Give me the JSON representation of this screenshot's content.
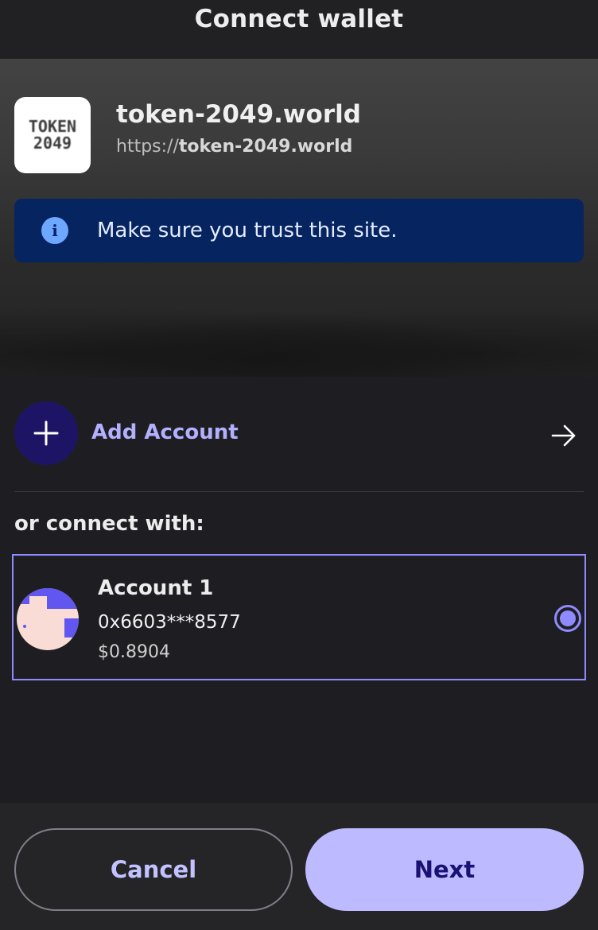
{
  "header": {
    "title": "Connect wallet"
  },
  "site": {
    "logo_line1": "TOKEN",
    "logo_line2": "2049",
    "name": "token-2049.world",
    "url_prefix": "https://",
    "url_host": "token-2049.world",
    "trust_message": "Make sure you trust this site."
  },
  "add_account": {
    "label": "Add Account",
    "icon": "plus-icon",
    "arrow_icon": "arrow-right-icon"
  },
  "connect_with_label": "or connect with:",
  "accounts": [
    {
      "name": "Account 1",
      "address": "0x6603***8577",
      "balance": "$0.8904",
      "selected": true
    }
  ],
  "footer": {
    "cancel_label": "Cancel",
    "next_label": "Next"
  },
  "colors": {
    "background": "#1e1e22",
    "accent": "#8f8bff",
    "accent_light": "#bdbaff",
    "banner": "#052460",
    "info_icon": "#6ea7ff"
  }
}
